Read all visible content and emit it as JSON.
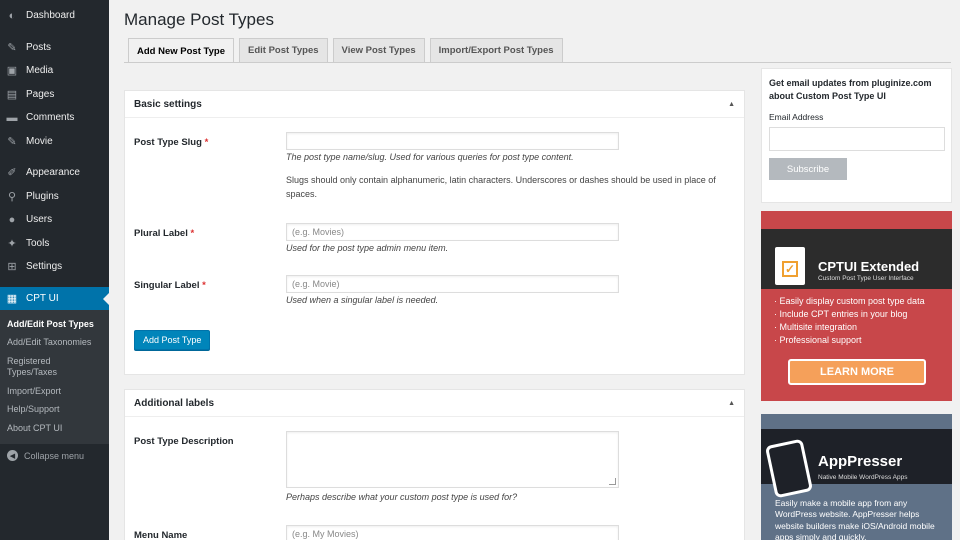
{
  "sidebar": {
    "items": [
      {
        "label": "Dashboard",
        "icon": "dashboard-icon",
        "glyph": "◐"
      },
      {
        "label": "Posts",
        "icon": "pin-icon",
        "glyph": "✎"
      },
      {
        "label": "Media",
        "icon": "media-icon",
        "glyph": "▣"
      },
      {
        "label": "Pages",
        "icon": "pages-icon",
        "glyph": "▤"
      },
      {
        "label": "Comments",
        "icon": "comments-icon",
        "glyph": "▬"
      },
      {
        "label": "Movie",
        "icon": "pin-icon",
        "glyph": "✎"
      },
      {
        "label": "Appearance",
        "icon": "brush-icon",
        "glyph": "✐"
      },
      {
        "label": "Plugins",
        "icon": "plugins-icon",
        "glyph": "⚲"
      },
      {
        "label": "Users",
        "icon": "users-icon",
        "glyph": "●"
      },
      {
        "label": "Tools",
        "icon": "tools-icon",
        "glyph": "✦"
      },
      {
        "label": "Settings",
        "icon": "settings-icon",
        "glyph": "⊞"
      },
      {
        "label": "CPT UI",
        "icon": "cptui-icon",
        "glyph": "▦"
      }
    ],
    "submenu": [
      "Add/Edit Post Types",
      "Add/Edit Taxonomies",
      "Registered Types/Taxes",
      "Import/Export",
      "Help/Support",
      "About CPT UI"
    ],
    "collapse_label": "Collapse menu"
  },
  "main": {
    "title": "Manage Post Types",
    "tabs": [
      {
        "label": "Add New Post Type",
        "active": true
      },
      {
        "label": "Edit Post Types",
        "active": false
      },
      {
        "label": "View Post Types",
        "active": false
      },
      {
        "label": "Import/Export Post Types",
        "active": false
      }
    ],
    "basic": {
      "heading": "Basic settings",
      "slug_label": "Post Type Slug",
      "required_mark": "*",
      "slug_value": "",
      "slug_desc": "The post type name/slug. Used for various queries for post type content.",
      "slug_note": "Slugs should only contain alphanumeric, latin characters. Underscores or dashes should be used in place of spaces.",
      "plural_label": "Plural Label",
      "plural_placeholder": "(e.g. Movies)",
      "plural_desc": "Used for the post type admin menu item.",
      "singular_label": "Singular Label",
      "singular_placeholder": "(e.g. Movie)",
      "singular_desc": "Used when a singular label is needed.",
      "add_button": "Add Post Type"
    },
    "additional": {
      "heading": "Additional labels",
      "desc_label": "Post Type Description",
      "desc_help": "Perhaps describe what your custom post type is used for?",
      "menu_label": "Menu Name",
      "menu_placeholder": "(e.g. My Movies)"
    }
  },
  "widgets": {
    "email": {
      "title": "Get email updates from pluginize.com about Custom Post Type UI",
      "field_label": "Email Address",
      "button": "Subscribe"
    },
    "extended": {
      "title": "CPTUI Extended",
      "subtitle": "Custom Post Type User Interface",
      "bullets": [
        "· Easily display custom post type data",
        "· Include CPT entries in your blog",
        "· Multisite integration",
        "· Professional support"
      ],
      "button": "LEARN MORE"
    },
    "apppresser": {
      "title": "AppPresser",
      "subtitle": "Native Mobile WordPress Apps",
      "body": "Easily make a mobile app from any WordPress website. AppPresser helps website builders make iOS/Android mobile apps simply and quickly."
    }
  },
  "colors": {
    "admin_bar": "#23282d",
    "accent": "#0073aa",
    "primary_button": "#0085ba",
    "extended_bg": "#c8474a",
    "extended_button": "#f5a05a",
    "apppresser_bg": "#5f7187"
  }
}
